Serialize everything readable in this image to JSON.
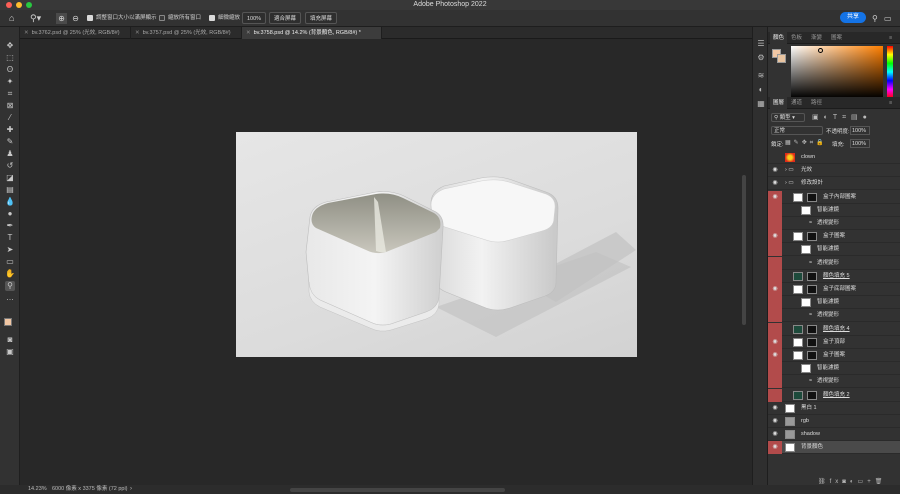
{
  "app": {
    "title": "Adobe Photoshop 2022"
  },
  "mac_colors": {
    "close": "#fe5f57",
    "min": "#febc2e",
    "max": "#28c840"
  },
  "options": {
    "zoom_icon": "zoom-icon",
    "resize_label": "調整窗口大小以滿屏顯示",
    "zoom_all_label": "縮放所有窗口",
    "scrubby_label": "細微縮放",
    "zoom_value": "100%",
    "fit_label": "適合屏幕",
    "fill_label": "填充屏幕",
    "share_label": "共享"
  },
  "tabs": [
    {
      "label": "bv.3762.psd @ 25% (光效, RGB/8#)",
      "active": false
    },
    {
      "label": "bv.3757.psd @ 25% (光效, RGB/8#)",
      "active": false
    },
    {
      "label": "bv.3758.psd @ 14.2% (背景顏色, RGB/8#) *",
      "active": true
    }
  ],
  "color_panel": {
    "tabs": [
      "顏色",
      "色板",
      "漸變",
      "圖案"
    ],
    "fg_color": "#f1c7a4",
    "bg_color": "#e8c4a0"
  },
  "layers_panel": {
    "tabs": [
      "圖層",
      "通道",
      "路徑"
    ],
    "filter_label": "類型",
    "blend_mode": "正常",
    "opacity_label": "不透明度:",
    "opacity_value": "100%",
    "lock_label": "鎖定:",
    "fill_label": "填充:",
    "fill_value": "100%",
    "layers": [
      {
        "name": "clown",
        "indent": 0,
        "thumb": "red",
        "eye": false,
        "red": false
      },
      {
        "name": "光效",
        "indent": 0,
        "thumb": "folder",
        "eye": true,
        "red": false
      },
      {
        "name": "修改設計",
        "indent": 0,
        "thumb": "folder",
        "eye": true,
        "red": false
      },
      {
        "name": "盒子內部圖案",
        "indent": 1,
        "thumb": "w",
        "eye": true,
        "red": true
      },
      {
        "name": "智能濾鏡",
        "indent": 2,
        "thumb": "w",
        "eye": false,
        "red": true
      },
      {
        "name": "透視變形",
        "indent": 3,
        "thumb": "none",
        "eye": false,
        "red": true
      },
      {
        "name": "盒子圖案",
        "indent": 1,
        "thumb": "w",
        "eye": true,
        "red": true
      },
      {
        "name": "智能濾鏡",
        "indent": 2,
        "thumb": "w",
        "eye": false,
        "red": true
      },
      {
        "name": "透視變形",
        "indent": 3,
        "thumb": "none",
        "eye": false,
        "red": true
      },
      {
        "name": "顏色填充 5",
        "indent": 1,
        "thumb": "dg",
        "eye": false,
        "red": true
      },
      {
        "name": "盒子底部圖案",
        "indent": 1,
        "thumb": "w",
        "eye": true,
        "red": true
      },
      {
        "name": "智能濾鏡",
        "indent": 2,
        "thumb": "w",
        "eye": false,
        "red": true
      },
      {
        "name": "透視變形",
        "indent": 3,
        "thumb": "none",
        "eye": false,
        "red": true
      },
      {
        "name": "顏色填充 4",
        "indent": 1,
        "thumb": "dg",
        "eye": false,
        "red": true
      },
      {
        "name": "盒子頂部",
        "indent": 1,
        "thumb": "w",
        "eye": true,
        "red": true
      },
      {
        "name": "盒子圖案",
        "indent": 1,
        "thumb": "w",
        "eye": true,
        "red": true
      },
      {
        "name": "智能濾鏡",
        "indent": 2,
        "thumb": "w",
        "eye": false,
        "red": true
      },
      {
        "name": "透視變形",
        "indent": 3,
        "thumb": "none",
        "eye": false,
        "red": true
      },
      {
        "name": "顏色填充 2",
        "indent": 1,
        "thumb": "dg",
        "eye": false,
        "red": true
      },
      {
        "name": "黑白 1",
        "indent": 0,
        "thumb": "w",
        "eye": true,
        "red": false
      },
      {
        "name": "rgb",
        "indent": 0,
        "thumb": "gr",
        "eye": true,
        "red": false
      },
      {
        "name": "shadow",
        "indent": 0,
        "thumb": "gr",
        "eye": true,
        "red": false
      },
      {
        "name": "背景顏色",
        "indent": 0,
        "thumb": "w",
        "eye": true,
        "red": true,
        "selected": true
      }
    ]
  },
  "status": {
    "zoom": "14.23%",
    "doc_info": "6000 像素 x 3375 像素 (72 ppi)"
  }
}
